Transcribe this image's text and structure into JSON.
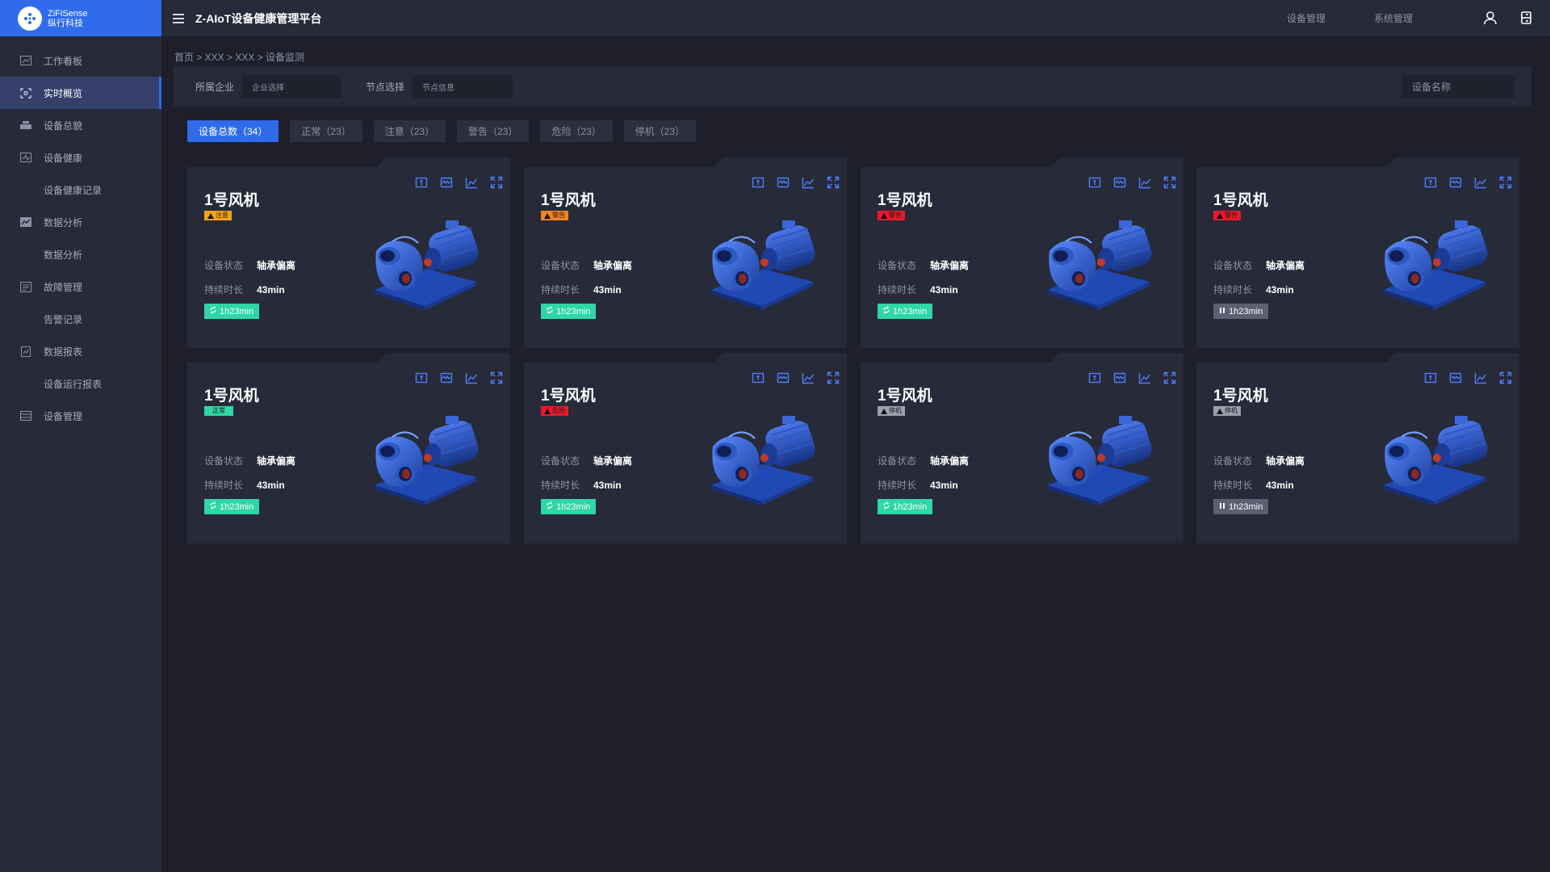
{
  "app": {
    "logo_brand": "ZiFiSense",
    "logo_sub": "纵行科技",
    "title": "Z-AIoT设备健康管理平台"
  },
  "colors": {
    "accent": "#2f6bea",
    "attention": "#f5a314",
    "warning": "#f5821f",
    "danger": "#e8192c",
    "normal": "#2fd6a6",
    "stopped": "#9aa0ad",
    "running_time": "#2fd6a6",
    "paused_time": "#5b6072"
  },
  "top_links": [
    "设备管理",
    "系统管理"
  ],
  "sidebar": {
    "items": [
      {
        "label": "工作看板",
        "icon": "dashboard-icon",
        "level": 1
      },
      {
        "label": "实时概览",
        "icon": "realtime-scan-icon",
        "level": 1,
        "active": true
      },
      {
        "label": "设备总貌",
        "icon": "devices-icon",
        "level": 1
      },
      {
        "label": "设备健康",
        "icon": "health-chart-icon",
        "level": 1
      },
      {
        "label": "设备健康记录",
        "level": 2
      },
      {
        "label": "数据分析",
        "icon": "analysis-icon",
        "level": 1
      },
      {
        "label": "数据分析",
        "level": 2
      },
      {
        "label": "故障管理",
        "icon": "fault-icon",
        "level": 1
      },
      {
        "label": "告警记录",
        "level": 2
      },
      {
        "label": "数据报表",
        "icon": "report-icon",
        "level": 1
      },
      {
        "label": "设备运行报表",
        "level": 2
      },
      {
        "label": "设备管理",
        "icon": "device-manage-icon",
        "level": 1
      }
    ]
  },
  "breadcrumb": "首页 > XXX > XXX > 设备监测",
  "filters": {
    "company_label": "所属企业",
    "company_placeholder": "企业选择",
    "node_label": "节点选择",
    "node_placeholder": "节点信息",
    "device_name_placeholder": "设备名称"
  },
  "tabs": [
    {
      "label": "设备总数（34）",
      "active": true
    },
    {
      "label": "正常（23）"
    },
    {
      "label": "注意（23）"
    },
    {
      "label": "警告（23）"
    },
    {
      "label": "危险（23）"
    },
    {
      "label": "停机（23）"
    }
  ],
  "card_fields": {
    "status_label": "设备状态",
    "duration_label": "持续时长"
  },
  "cards": [
    {
      "name": "1号风机",
      "badge": "注意",
      "badge_color": "#f5a314",
      "status": "轴承偏离",
      "duration": "43min",
      "time": "1h23min",
      "time_state": "running"
    },
    {
      "name": "1号风机",
      "badge": "警告",
      "badge_color": "#f5821f",
      "status": "轴承偏离",
      "duration": "43min",
      "time": "1h23min",
      "time_state": "running"
    },
    {
      "name": "1号风机",
      "badge": "警告",
      "badge_color": "#e8192c",
      "status": "轴承偏离",
      "duration": "43min",
      "time": "1h23min",
      "time_state": "running"
    },
    {
      "name": "1号风机",
      "badge": "警告",
      "badge_color": "#e8192c",
      "status": "轴承偏离",
      "duration": "43min",
      "time": "1h23min",
      "time_state": "paused"
    },
    {
      "name": "1号风机",
      "badge": "正常",
      "badge_color": "#2fd6a6",
      "status": "轴承偏离",
      "duration": "43min",
      "time": "1h23min",
      "time_state": "running"
    },
    {
      "name": "1号风机",
      "badge": "危险",
      "badge_color": "#e8192c",
      "status": "轴承偏离",
      "duration": "43min",
      "time": "1h23min",
      "time_state": "running"
    },
    {
      "name": "1号风机",
      "badge": "停机",
      "badge_color": "#9aa0ad",
      "status": "轴承偏离",
      "duration": "43min",
      "time": "1h23min",
      "time_state": "running"
    },
    {
      "name": "1号风机",
      "badge": "停机",
      "badge_color": "#9aa0ad",
      "status": "轴承偏离",
      "duration": "43min",
      "time": "1h23min",
      "time_state": "paused"
    }
  ]
}
